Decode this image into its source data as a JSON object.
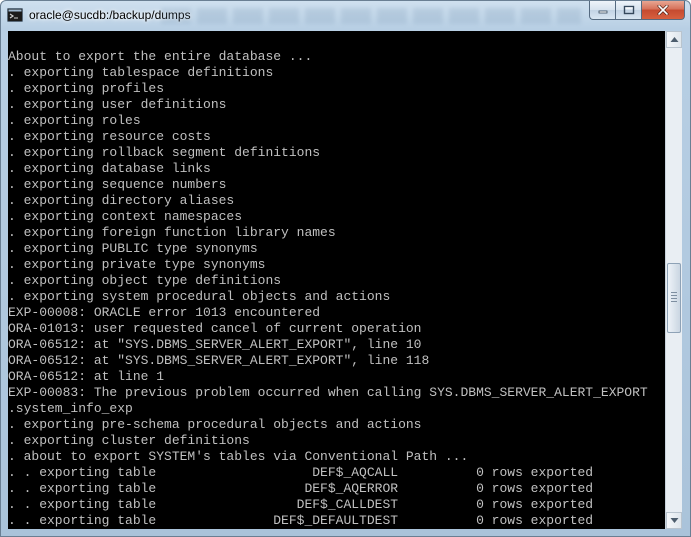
{
  "window": {
    "title": "oracle@sucdb:/backup/dumps",
    "app_icon": "terminal-app-icon",
    "buttons": {
      "minimize_icon": "minimize-icon",
      "maximize_icon": "maximize-icon",
      "close_icon": "close-icon"
    }
  },
  "colors": {
    "console_background": "#000000",
    "console_text": "#c0c0c0",
    "close_button": "#c54a2f"
  },
  "terminal": {
    "lines": [
      "About to export the entire database ...",
      ". exporting tablespace definitions",
      ". exporting profiles",
      ". exporting user definitions",
      ". exporting roles",
      ". exporting resource costs",
      ". exporting rollback segment definitions",
      ". exporting database links",
      ". exporting sequence numbers",
      ". exporting directory aliases",
      ". exporting context namespaces",
      ". exporting foreign function library names",
      ". exporting PUBLIC type synonyms",
      ". exporting private type synonyms",
      ". exporting object type definitions",
      ". exporting system procedural objects and actions",
      "EXP-00008: ORACLE error 1013 encountered",
      "ORA-01013: user requested cancel of current operation",
      "ORA-06512: at \"SYS.DBMS_SERVER_ALERT_EXPORT\", line 10",
      "ORA-06512: at \"SYS.DBMS_SERVER_ALERT_EXPORT\", line 118",
      "ORA-06512: at line 1",
      "EXP-00083: The previous problem occurred when calling SYS.DBMS_SERVER_ALERT_EXPORT",
      ".system_info_exp",
      ". exporting pre-schema procedural objects and actions",
      ". exporting cluster definitions",
      ". about to export SYSTEM's tables via Conventional Path ...",
      ". . exporting table                    DEF$_AQCALL          0 rows exported",
      ". . exporting table                   DEF$_AQERROR          0 rows exported",
      ". . exporting table                  DEF$_CALLDEST          0 rows exported",
      ". . exporting table               DEF$_DEFAULTDEST          0 rows exported"
    ]
  },
  "scrollbar": {
    "up_icon": "scroll-up-arrow-icon",
    "down_icon": "scroll-down-arrow-icon"
  }
}
